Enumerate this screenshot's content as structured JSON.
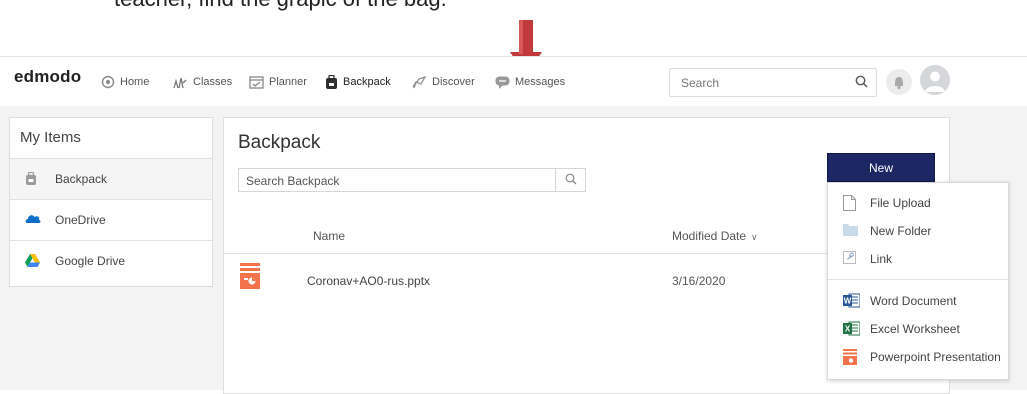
{
  "caption": "teacher, find the grapic of the bag.",
  "nav": {
    "logo": "edmodo",
    "items": [
      {
        "label": "Home",
        "icon": "home-icon"
      },
      {
        "label": "Classes",
        "icon": "classes-icon"
      },
      {
        "label": "Planner",
        "icon": "planner-icon"
      },
      {
        "label": "Backpack",
        "icon": "backpack-icon",
        "active": true
      },
      {
        "label": "Discover",
        "icon": "discover-icon"
      },
      {
        "label": "Messages",
        "icon": "messages-icon"
      }
    ],
    "search_placeholder": "Search"
  },
  "sidebar": {
    "title": "My Items",
    "items": [
      {
        "label": "Backpack",
        "icon": "backpack-icon"
      },
      {
        "label": "OneDrive",
        "icon": "onedrive-icon"
      },
      {
        "label": "Google Drive",
        "icon": "google-drive-icon"
      }
    ]
  },
  "main": {
    "title": "Backpack",
    "search_placeholder": "Search Backpack",
    "columns": {
      "name": "Name",
      "modified": "Modified Date"
    },
    "files": [
      {
        "name": "Coronav+AO0-rus.pptx",
        "date": "3/16/2020",
        "icon": "powerpoint-file-icon"
      }
    ]
  },
  "new_button": "New",
  "new_menu": {
    "items": [
      {
        "label": "File Upload",
        "icon": "file-icon"
      },
      {
        "label": "New Folder",
        "icon": "folder-icon"
      },
      {
        "label": "Link",
        "icon": "link-icon"
      },
      {
        "label": "Word Document",
        "icon": "word-icon"
      },
      {
        "label": "Excel Worksheet",
        "icon": "excel-icon"
      },
      {
        "label": "Powerpoint Presentation",
        "icon": "powerpoint-icon"
      }
    ]
  },
  "colors": {
    "accent_navy": "#1c2764",
    "arrow_red": "#c0393b",
    "powerpoint_orange": "#f2734c",
    "word_blue": "#2b579a",
    "excel_green": "#217346"
  }
}
